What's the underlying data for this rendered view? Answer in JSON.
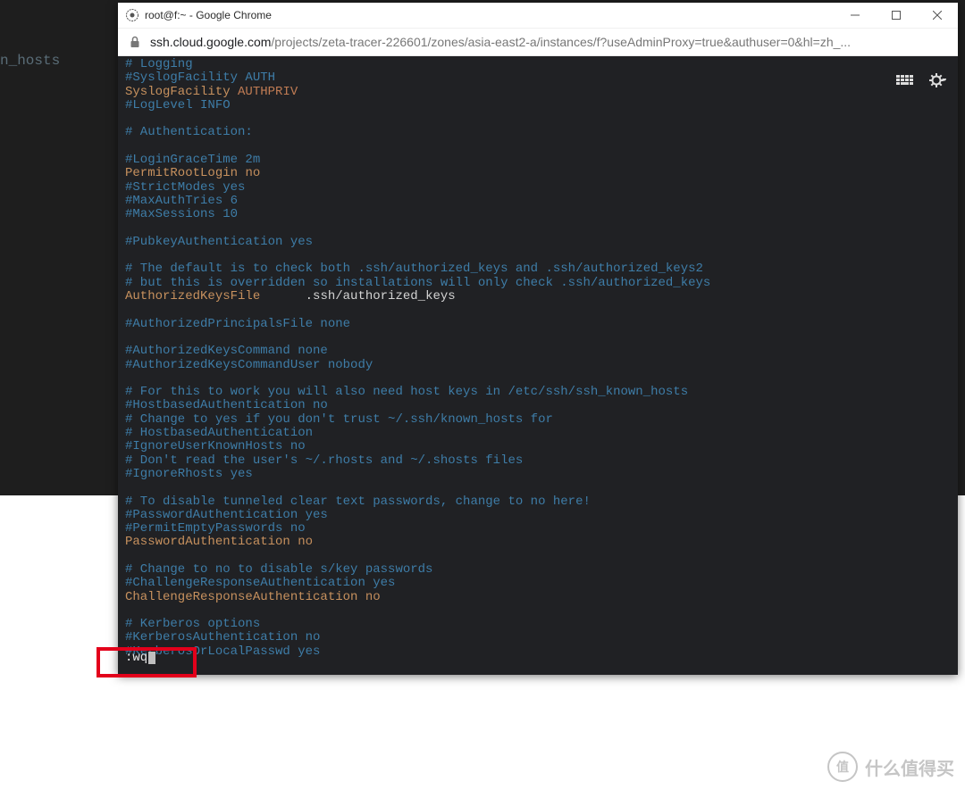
{
  "background_fragment": "n_hosts",
  "window": {
    "title": "root@f:~ - Google Chrome",
    "url_host": "ssh.cloud.google.com",
    "url_path": "/projects/zeta-tracer-226601/zones/asia-east2-a/instances/f?useAdminProxy=true&authuser=0&hl=zh_..."
  },
  "vim_command": ":wq",
  "watermark": {
    "badge": "值",
    "text": "什么值得买"
  },
  "lines": [
    [
      [
        "c-comment",
        "# Logging"
      ]
    ],
    [
      [
        "c-comment",
        "#SyslogFacility AUTH"
      ]
    ],
    [
      [
        "c-key",
        "SyslogFacility"
      ],
      [
        "c-white",
        " "
      ],
      [
        "c-val",
        "AUTHPRIV"
      ]
    ],
    [
      [
        "c-comment",
        "#LogLevel INFO"
      ]
    ],
    [
      [
        "",
        ""
      ]
    ],
    [
      [
        "c-comment",
        "# Authentication:"
      ]
    ],
    [
      [
        "",
        ""
      ]
    ],
    [
      [
        "c-comment",
        "#LoginGraceTime 2m"
      ]
    ],
    [
      [
        "c-key",
        "PermitRootLogin"
      ],
      [
        "c-white",
        " "
      ],
      [
        "c-noval",
        "no"
      ]
    ],
    [
      [
        "c-comment",
        "#StrictModes yes"
      ]
    ],
    [
      [
        "c-comment",
        "#MaxAuthTries 6"
      ]
    ],
    [
      [
        "c-comment",
        "#MaxSessions 10"
      ]
    ],
    [
      [
        "",
        ""
      ]
    ],
    [
      [
        "c-comment",
        "#PubkeyAuthentication yes"
      ]
    ],
    [
      [
        "",
        ""
      ]
    ],
    [
      [
        "c-comment",
        "# The default is to check both .ssh/authorized_keys and .ssh/authorized_keys2"
      ]
    ],
    [
      [
        "c-comment",
        "# but this is overridden so installations will only check .ssh/authorized_keys"
      ]
    ],
    [
      [
        "c-key",
        "AuthorizedKeysFile"
      ],
      [
        "c-white",
        "      .ssh/authorized_keys"
      ]
    ],
    [
      [
        "",
        ""
      ]
    ],
    [
      [
        "c-comment",
        "#AuthorizedPrincipalsFile none"
      ]
    ],
    [
      [
        "",
        ""
      ]
    ],
    [
      [
        "c-comment",
        "#AuthorizedKeysCommand none"
      ]
    ],
    [
      [
        "c-comment",
        "#AuthorizedKeysCommandUser nobody"
      ]
    ],
    [
      [
        "",
        ""
      ]
    ],
    [
      [
        "c-comment",
        "# For this to work you will also need host keys in /etc/ssh/ssh_known_hosts"
      ]
    ],
    [
      [
        "c-comment",
        "#HostbasedAuthentication no"
      ]
    ],
    [
      [
        "c-comment",
        "# Change to yes if you don't trust ~/.ssh/known_hosts for"
      ]
    ],
    [
      [
        "c-comment",
        "# HostbasedAuthentication"
      ]
    ],
    [
      [
        "c-comment",
        "#IgnoreUserKnownHosts no"
      ]
    ],
    [
      [
        "c-comment",
        "# Don't read the user's ~/.rhosts and ~/.shosts files"
      ]
    ],
    [
      [
        "c-comment",
        "#IgnoreRhosts yes"
      ]
    ],
    [
      [
        "",
        ""
      ]
    ],
    [
      [
        "c-comment",
        "# To disable tunneled clear text passwords, change to no here!"
      ]
    ],
    [
      [
        "c-comment",
        "#PasswordAuthentication yes"
      ]
    ],
    [
      [
        "c-comment",
        "#PermitEmptyPasswords no"
      ]
    ],
    [
      [
        "c-key",
        "PasswordAuthentication"
      ],
      [
        "c-white",
        " "
      ],
      [
        "c-noval",
        "no"
      ]
    ],
    [
      [
        "",
        ""
      ]
    ],
    [
      [
        "c-comment",
        "# Change to no to disable s/key passwords"
      ]
    ],
    [
      [
        "c-comment",
        "#ChallengeResponseAuthentication yes"
      ]
    ],
    [
      [
        "c-key",
        "ChallengeResponseAuthentication"
      ],
      [
        "c-white",
        " "
      ],
      [
        "c-noval",
        "no"
      ]
    ],
    [
      [
        "",
        ""
      ]
    ],
    [
      [
        "c-comment",
        "# Kerberos options"
      ]
    ],
    [
      [
        "c-comment",
        "#KerberosAuthentication no"
      ]
    ],
    [
      [
        "c-comment",
        "#KerberosOrLocalPasswd yes"
      ]
    ]
  ]
}
